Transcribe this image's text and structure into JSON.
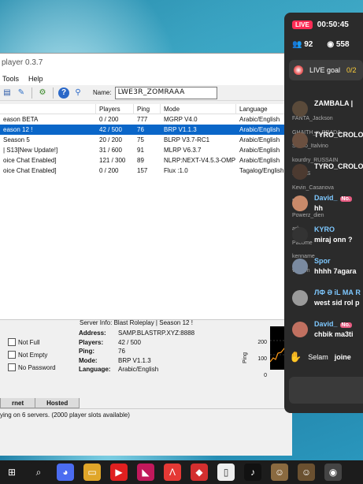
{
  "window": {
    "title": "player 0.3.7",
    "menu": [
      "Tools",
      "Help"
    ],
    "name_label": "Name:",
    "name_value": "LWE3R_ZOMRAAA"
  },
  "table": {
    "headers": [
      "",
      "Players",
      "Ping",
      "Mode",
      "Language"
    ],
    "rows": [
      {
        "name": "eason BETA",
        "players": "0 / 200",
        "ping": "777",
        "mode": "MGRP V4.0",
        "lang": "Arabic/English",
        "selected": false
      },
      {
        "name": "eason 12 !",
        "players": "42 / 500",
        "ping": "76",
        "mode": "BRP V1.1.3",
        "lang": "Arabic/English",
        "selected": true
      },
      {
        "name": "Season 5",
        "players": "20 / 200",
        "ping": "75",
        "mode": "BLRP V3.7-RC1",
        "lang": "Arabic/English",
        "selected": false
      },
      {
        "name": "| S13[New Update!]",
        "players": "31 / 600",
        "ping": "91",
        "mode": "MLRP V6.3.7",
        "lang": "Arabic/English",
        "selected": false
      },
      {
        "name": "oice Chat Enabled]",
        "players": "121 / 300",
        "ping": "89",
        "mode": "NLRP:NEXT-V4.5.3-OMP",
        "lang": "Arabic/English",
        "selected": false
      },
      {
        "name": "oice Chat Enabled]",
        "players": "0 / 200",
        "ping": "157",
        "mode": "Flux :1.0",
        "lang": "Tagalog/English",
        "selected": false
      }
    ]
  },
  "filters": {
    "not_full": "Not Full",
    "not_empty": "Not Empty",
    "no_password": "No Password"
  },
  "server_info": {
    "title": "Server Info: Blast Roleplay | Season 12 !",
    "address_k": "Address:",
    "address": "SAMP.BLASTRP.XYZ:8888",
    "players_k": "Players:",
    "players": "42 / 500",
    "ping_k": "Ping:",
    "ping": "76",
    "mode_k": "Mode:",
    "mode": "BRP V1.1.3",
    "language_k": "Language:",
    "language": "Arabic/English",
    "ping_axis_label": "Ping",
    "ping_ticks": [
      "200",
      "100",
      "0"
    ]
  },
  "tabs": [
    "rnet",
    "Hosted"
  ],
  "status": "ying on 6 servers. (2000 player slots available)",
  "chat": {
    "live": "LIVE",
    "timer": "00:50:45",
    "viewers": "92",
    "views": "558",
    "goal": "LIVE goal",
    "goal_value": "0/2",
    "messages": [
      {
        "user": "ZAMBALA |",
        "text": "",
        "badge": ""
      },
      {
        "user": "TYRO_CROLO",
        "text": "",
        "badge": ""
      },
      {
        "user": "TYRO_CROLO",
        "text": "",
        "badge": ""
      },
      {
        "user": "David_",
        "text": "hh",
        "badge": "No."
      },
      {
        "user": "KYRO",
        "text": "miraj onn ?",
        "badge": ""
      },
      {
        "user": "Spor",
        "text": "hhhh 7agara",
        "badge": ""
      },
      {
        "user": "ЛФ Ә іL МА R",
        "text": "west sid rol p",
        "badge": ""
      },
      {
        "user": "David_",
        "text": "chbik ma3ti",
        "badge": "No."
      }
    ],
    "ghost": [
      "FANTA_Jackson",
      "GHAITH_x_PRADA",
      "Senso_Italvino",
      "kourdry_RUSSAIN",
      "LGASS",
      "Kevin_Casanova",
      "Rule",
      "Powerz_dien",
      "arb",
      "Pacome",
      "kenname",
      "version"
    ],
    "selam": "Selam",
    "joined": "joine"
  },
  "taskbar_icons": [
    "windows-icon",
    "search-icon",
    "game-icon",
    "folder-icon",
    "youtube-icon",
    "vs-icon",
    "arrow-app-icon",
    "store-icon",
    "file-icon",
    "tiktok-icon",
    "avatar-app-icon",
    "avatar-app2-icon",
    "obs-icon"
  ]
}
